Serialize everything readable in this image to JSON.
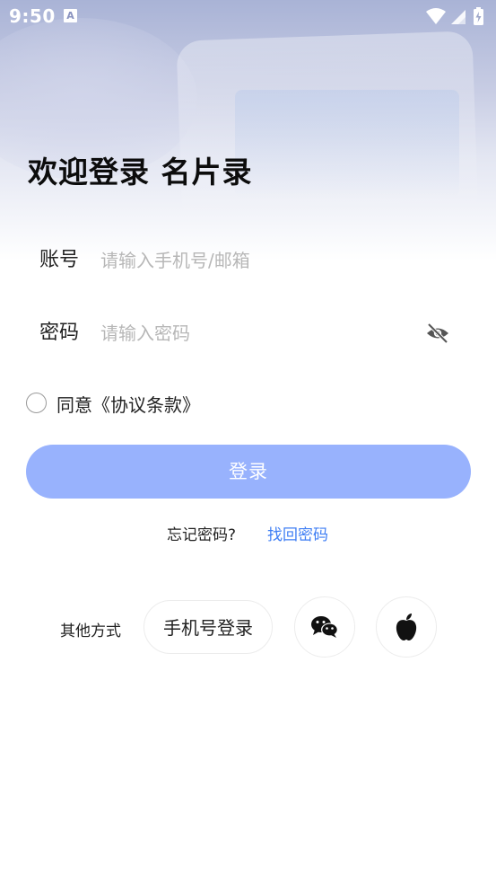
{
  "status_bar": {
    "time": "9:50",
    "notification_icon_letter": "A"
  },
  "page": {
    "title": "欢迎登录 名片录"
  },
  "account_field": {
    "label": "账号",
    "placeholder": "请输入手机号/邮箱",
    "value": ""
  },
  "password_field": {
    "label": "密码",
    "placeholder": "请输入密码",
    "value": "",
    "visibility_icon": "eye-off-icon"
  },
  "agreement": {
    "checked": false,
    "label": "同意《协议条款》"
  },
  "login_button": {
    "label": "登录"
  },
  "forgot": {
    "prompt": "忘记密码?",
    "link": "找回密码"
  },
  "other_login": {
    "label": "其他方式",
    "phone_button": "手机号登录",
    "wechat_icon": "wechat-icon",
    "apple_icon": "apple-icon"
  },
  "colors": {
    "primary_button": "#98b2fd",
    "link": "#3f7ef4"
  }
}
